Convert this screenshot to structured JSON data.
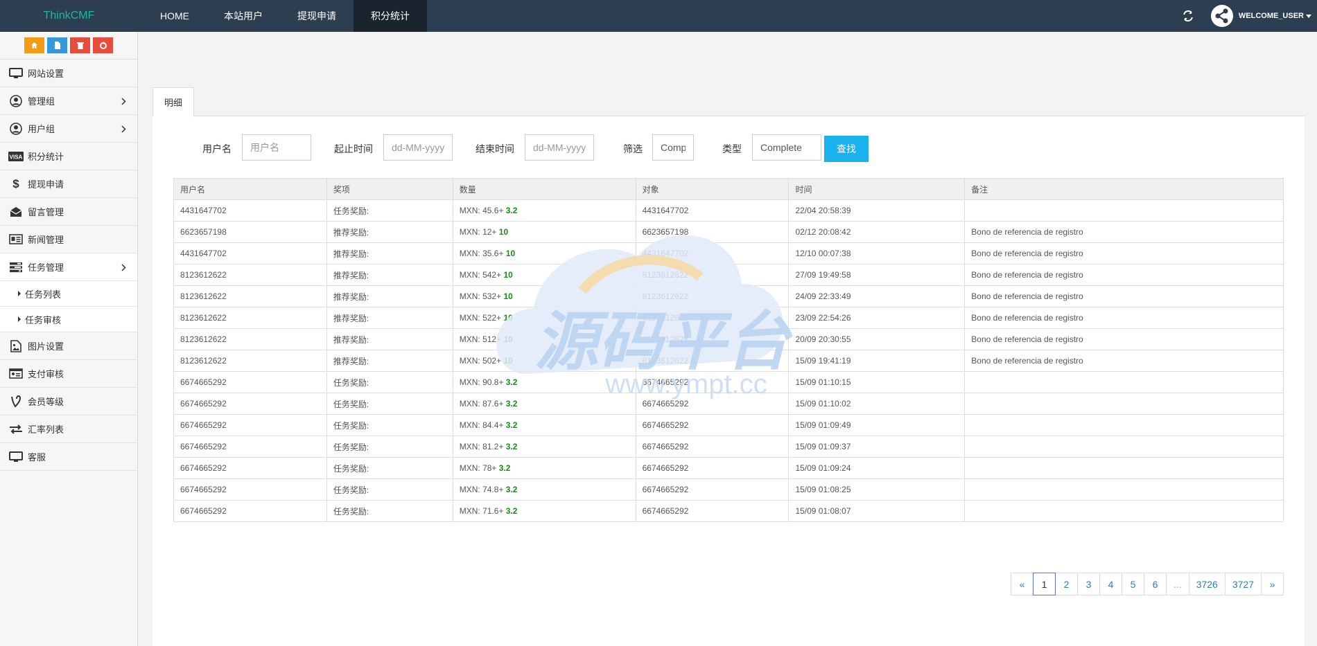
{
  "brand": "ThinkCMF",
  "nav": [
    "HOME",
    "本站用户",
    "提现申请",
    "积分统计"
  ],
  "user": "WELCOME_USER",
  "sidebar": {
    "items": [
      {
        "label": "网站设置",
        "icon": "monitor-icon"
      },
      {
        "label": "管理组",
        "icon": "user-circle-icon"
      },
      {
        "label": "用户组",
        "icon": "user-circle-icon"
      },
      {
        "label": "积分统计",
        "icon": "visa-icon"
      },
      {
        "label": "提现申请",
        "icon": "dollar-icon"
      },
      {
        "label": "留言管理",
        "icon": "envelope-icon"
      },
      {
        "label": "新闻管理",
        "icon": "newspaper-icon"
      },
      {
        "label": "任务管理",
        "icon": "tasks-icon"
      },
      {
        "label": "图片设置",
        "icon": "image-icon"
      },
      {
        "label": "支付审核",
        "icon": "id-card-icon"
      },
      {
        "label": "会员等级",
        "icon": "vine-icon"
      },
      {
        "label": "汇率列表",
        "icon": "exchange-icon"
      },
      {
        "label": "客服",
        "icon": "monitor-icon"
      }
    ],
    "subitems": [
      "任务列表",
      "任务审核"
    ]
  },
  "tab": "明细",
  "filters": {
    "username_label": "用户名",
    "username_placeholder": "用户名",
    "start_label": "起止时间",
    "start_placeholder": "dd-MM-yyyy",
    "end_label": "结束时间",
    "end_placeholder": "dd-MM-yyyy",
    "screen_label": "筛选",
    "screen_value": "Complete",
    "type_label": "类型",
    "type_value": "Complete",
    "search_button": "查找"
  },
  "table": {
    "headers": [
      "用户名",
      "奖项",
      "数量",
      "对象",
      "时间",
      "备注"
    ],
    "rows": [
      {
        "user": "4431647702",
        "award": "任务奖励:",
        "amount": "MXN: 45.6+",
        "bonus": "3.2",
        "target": "4431647702",
        "time": "22/04 20:58:39",
        "note": ""
      },
      {
        "user": "6623657198",
        "award": "推荐奖励:",
        "amount": "MXN: 12+",
        "bonus": "10",
        "target": "6623657198",
        "time": "02/12 20:08:42",
        "note": "Bono de referencia de registro"
      },
      {
        "user": "4431647702",
        "award": "推荐奖励:",
        "amount": "MXN: 35.6+",
        "bonus": "10",
        "target": "4431647702",
        "time": "12/10 00:07:38",
        "note": "Bono de referencia de registro"
      },
      {
        "user": "8123612622",
        "award": "推荐奖励:",
        "amount": "MXN: 542+",
        "bonus": "10",
        "target": "8123612622",
        "time": "27/09 19:49:58",
        "note": "Bono de referencia de registro"
      },
      {
        "user": "8123612622",
        "award": "推荐奖励:",
        "amount": "MXN: 532+",
        "bonus": "10",
        "target": "8123612622",
        "time": "24/09 22:33:49",
        "note": "Bono de referencia de registro"
      },
      {
        "user": "8123612622",
        "award": "推荐奖励:",
        "amount": "MXN: 522+",
        "bonus": "10",
        "target": "8123612622",
        "time": "23/09 22:54:26",
        "note": "Bono de referencia de registro"
      },
      {
        "user": "8123612622",
        "award": "推荐奖励:",
        "amount": "MXN: 512+",
        "bonus": "10",
        "target": "8123612622",
        "time": "20/09 20:30:55",
        "note": "Bono de referencia de registro"
      },
      {
        "user": "8123612622",
        "award": "推荐奖励:",
        "amount": "MXN: 502+",
        "bonus": "10",
        "target": "8123612622",
        "time": "15/09 19:41:19",
        "note": "Bono de referencia de registro"
      },
      {
        "user": "6674665292",
        "award": "任务奖励:",
        "amount": "MXN: 90.8+",
        "bonus": "3.2",
        "target": "6674665292",
        "time": "15/09 01:10:15",
        "note": ""
      },
      {
        "user": "6674665292",
        "award": "任务奖励:",
        "amount": "MXN: 87.6+",
        "bonus": "3.2",
        "target": "6674665292",
        "time": "15/09 01:10:02",
        "note": ""
      },
      {
        "user": "6674665292",
        "award": "任务奖励:",
        "amount": "MXN: 84.4+",
        "bonus": "3.2",
        "target": "6674665292",
        "time": "15/09 01:09:49",
        "note": ""
      },
      {
        "user": "6674665292",
        "award": "任务奖励:",
        "amount": "MXN: 81.2+",
        "bonus": "3.2",
        "target": "6674665292",
        "time": "15/09 01:09:37",
        "note": ""
      },
      {
        "user": "6674665292",
        "award": "任务奖励:",
        "amount": "MXN: 78+",
        "bonus": "3.2",
        "target": "6674665292",
        "time": "15/09 01:09:24",
        "note": ""
      },
      {
        "user": "6674665292",
        "award": "任务奖励:",
        "amount": "MXN: 74.8+",
        "bonus": "3.2",
        "target": "6674665292",
        "time": "15/09 01:08:25",
        "note": ""
      },
      {
        "user": "6674665292",
        "award": "任务奖励:",
        "amount": "MXN: 71.6+",
        "bonus": "3.2",
        "target": "6674665292",
        "time": "15/09 01:08:07",
        "note": ""
      }
    ]
  },
  "pagination": [
    "«",
    "1",
    "2",
    "3",
    "4",
    "5",
    "6",
    "...",
    "3726",
    "3727",
    "»"
  ],
  "watermark": {
    "title": "源码平台",
    "url": "www.ympt.cc"
  },
  "colors": {
    "nav_bg": "#2c3e50",
    "brand": "#18bc9c",
    "search": "#1ab1ec",
    "bonus": "#1a8a1a"
  }
}
